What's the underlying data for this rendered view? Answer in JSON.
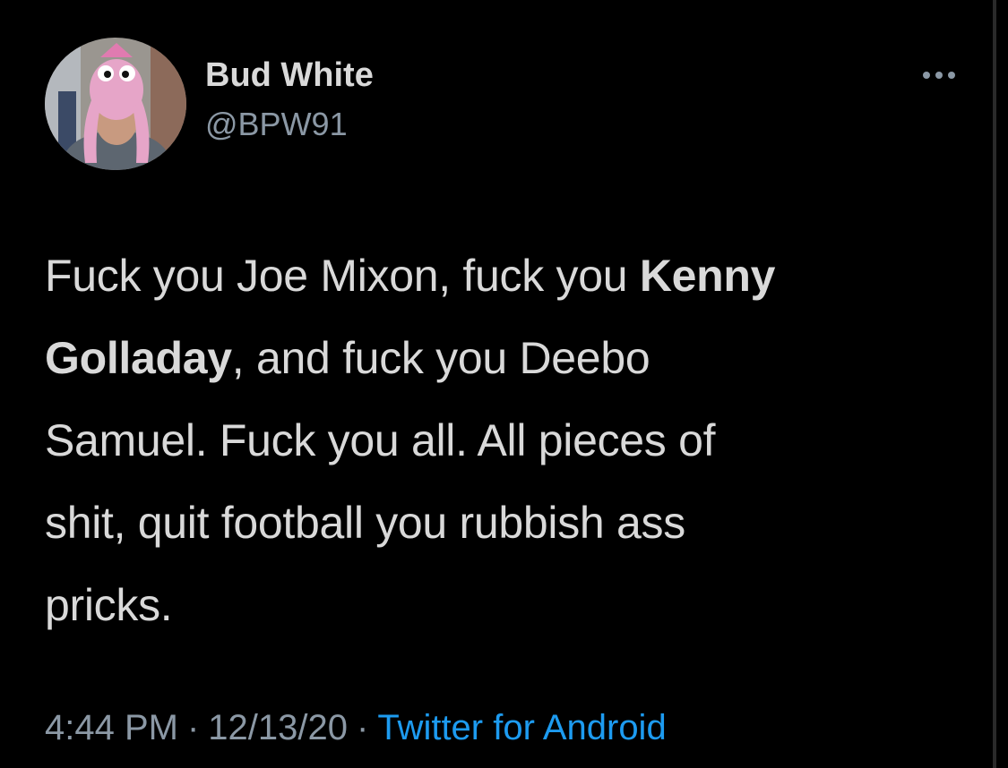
{
  "author": {
    "display_name": "Bud White",
    "handle": "@BPW91"
  },
  "header": {
    "more_icon": "more-horizontal-icon"
  },
  "tweet": {
    "segments": [
      {
        "text": "Fuck you Joe Mixon, fuck you ",
        "bold": false
      },
      {
        "text": "Kenny",
        "bold": true
      },
      {
        "text": "Golladay",
        "bold": true
      },
      {
        "text": ", and fuck you Deebo",
        "bold": false
      },
      {
        "text": "Samuel. Fuck you all. All pieces of",
        "bold": false
      },
      {
        "text": "shit, quit football you rubbish ass",
        "bold": false
      },
      {
        "text": "pricks.",
        "bold": false
      }
    ]
  },
  "meta": {
    "time": "4:44 PM",
    "separator": "·",
    "date": "12/13/20",
    "source": "Twitter for Android"
  },
  "colors": {
    "background": "#000000",
    "text": "#d9d9d9",
    "secondary": "#8b98a5",
    "link": "#1d9bf0"
  }
}
